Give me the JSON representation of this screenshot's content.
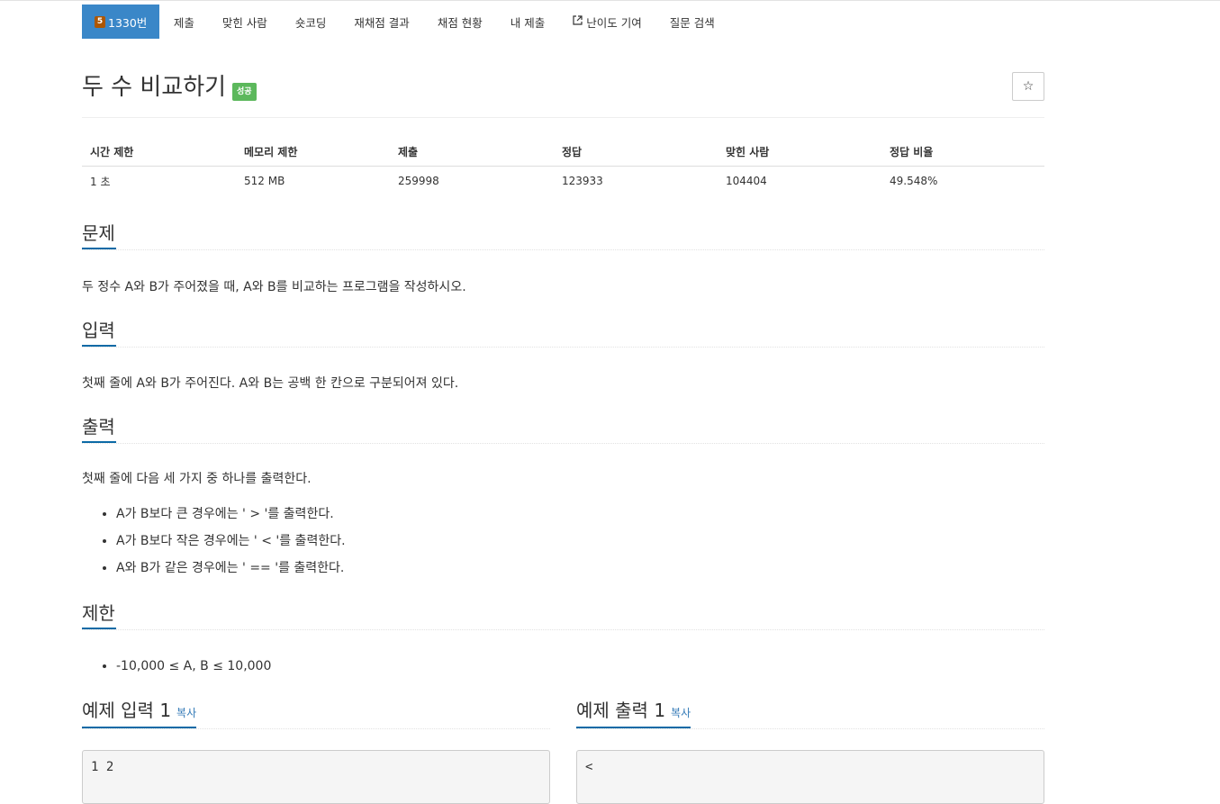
{
  "nav": {
    "tier_level": "5",
    "problem_tab": "1330번",
    "tabs": [
      "제출",
      "맞힌 사람",
      "숏코딩",
      "재채점 결과",
      "채점 현황",
      "내 제출",
      "난이도 기여",
      "질문 검색"
    ]
  },
  "problem": {
    "title": "두 수 비교하기",
    "status_badge": "성공",
    "star": "☆"
  },
  "info_table": {
    "headers": [
      "시간 제한",
      "메모리 제한",
      "제출",
      "정답",
      "맞힌 사람",
      "정답 비율"
    ],
    "values": [
      "1 초",
      "512 MB",
      "259998",
      "123933",
      "104404",
      "49.548%"
    ]
  },
  "sections": {
    "description": {
      "heading": "문제",
      "text": "두 정수 A와 B가 주어졌을 때, A와 B를 비교하는 프로그램을 작성하시오."
    },
    "input": {
      "heading": "입력",
      "text": "첫째 줄에 A와 B가 주어진다. A와 B는 공백 한 칸으로 구분되어져 있다."
    },
    "output": {
      "heading": "출력",
      "text": "첫째 줄에 다음 세 가지 중 하나를 출력한다.",
      "items": [
        "A가 B보다 큰 경우에는 ' > '를 출력한다.",
        "A가 B보다 작은 경우에는 ' < '를 출력한다.",
        "A와 B가 같은 경우에는 ' == '를 출력한다."
      ]
    },
    "limit": {
      "heading": "제한",
      "items": [
        "-10,000 ≤ A, B ≤ 10,000"
      ]
    }
  },
  "samples": {
    "input": {
      "heading": "예제 입력 1",
      "copy": "복사",
      "content": "1 2"
    },
    "output": {
      "heading": "예제 출력 1",
      "copy": "복사",
      "content": "<"
    }
  },
  "colors": {
    "accent": "#3a87c8",
    "success": "#5cb85c",
    "tier_bronze": "#ad5600",
    "section_underline": "#0c6aa6",
    "link": "#337ab7"
  }
}
